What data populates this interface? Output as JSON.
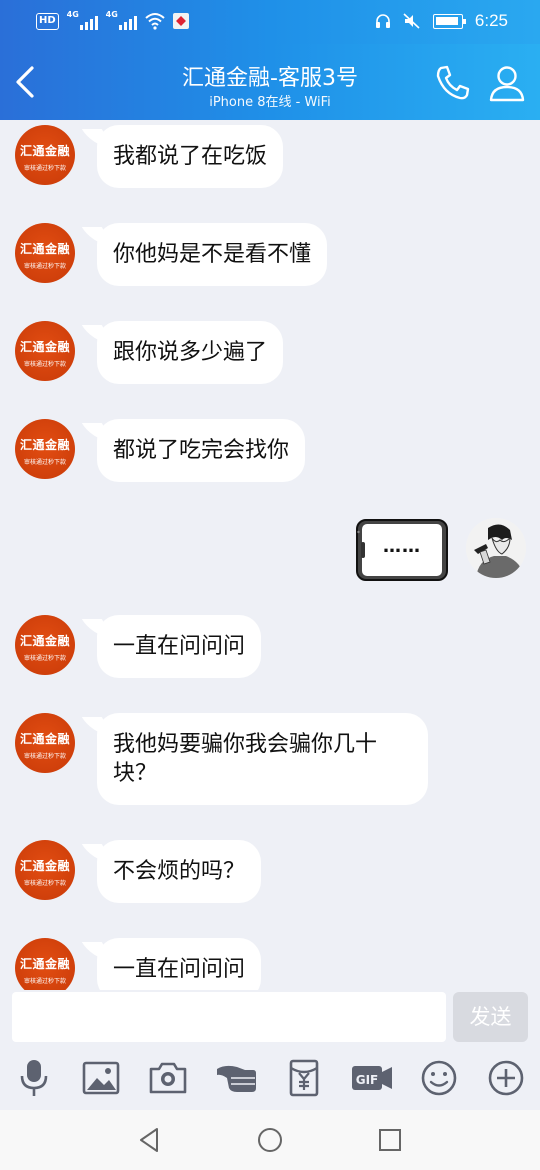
{
  "status": {
    "hd": "HD",
    "sim1": "4G",
    "sim2": "4G",
    "time": "6:25"
  },
  "header": {
    "title": "汇通金融-客服3号",
    "subtitle": "iPhone 8在线 - WiFi"
  },
  "contact_avatar": {
    "main": "汇通金融",
    "sub": "审核通过秒下款"
  },
  "messages": [
    {
      "from": "them",
      "text": "我都说了在吃饭"
    },
    {
      "from": "them",
      "text": "你他妈是不是看不懂"
    },
    {
      "from": "them",
      "text": "跟你说多少遍了"
    },
    {
      "from": "them",
      "text": "都说了吃完会找你"
    },
    {
      "from": "me",
      "text": "……"
    },
    {
      "from": "them",
      "text": "一直在问问问"
    },
    {
      "from": "them",
      "text": "我他妈要骗你我会骗你几十块？"
    },
    {
      "from": "them",
      "text": "不会烦的吗？"
    },
    {
      "from": "them",
      "text": "一直在问问问"
    }
  ],
  "input": {
    "value": "",
    "send_label": "发送"
  },
  "toolbar": [
    "mic-icon",
    "image-icon",
    "camera-icon",
    "poke-icon",
    "red-packet-icon",
    "gif-icon",
    "emoji-icon",
    "plus-icon"
  ],
  "colors": {
    "header": "#1f90e8",
    "avatar": "#d9440e",
    "chat_bg": "#eef0f6",
    "send_disabled": "#d8dae0"
  }
}
